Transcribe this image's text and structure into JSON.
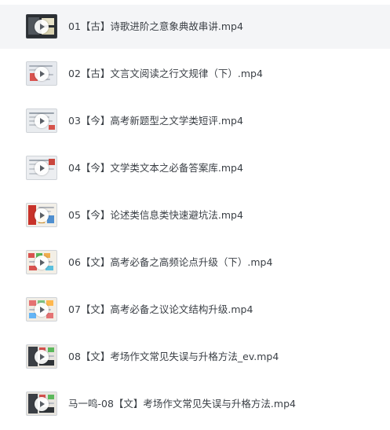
{
  "files": [
    {
      "name": "01【古】诗歌进阶之意象典故串讲.mp4",
      "thumb": "dark",
      "selected": true
    },
    {
      "name": "02【古】文言文阅读之行文规律（下）.mp4",
      "thumb": "light"
    },
    {
      "name": "03【今】高考新题型之文学类短评.mp4",
      "thumb": "light"
    },
    {
      "name": "04【今】文学类文本之必备答案库.mp4",
      "thumb": "light"
    },
    {
      "name": "05【今】论述类信息类快速避坑法.mp4",
      "thumb": "red"
    },
    {
      "name": "06【文】高考必备之高频论点升级（下）.mp4",
      "thumb": "colorful"
    },
    {
      "name": "07【文】高考必备之议论文结构升级.mp4",
      "thumb": "colorful"
    },
    {
      "name": "08【文】考场作文常见失误与升格方法_ev.mp4",
      "thumb": "mixed"
    },
    {
      "name": "马一鸣-08【文】考场作文常见失误与升格方法.mp4",
      "thumb": "mixed"
    }
  ],
  "colors": {
    "selected_row": "#f4f5f7",
    "text": "#3a3f45"
  }
}
